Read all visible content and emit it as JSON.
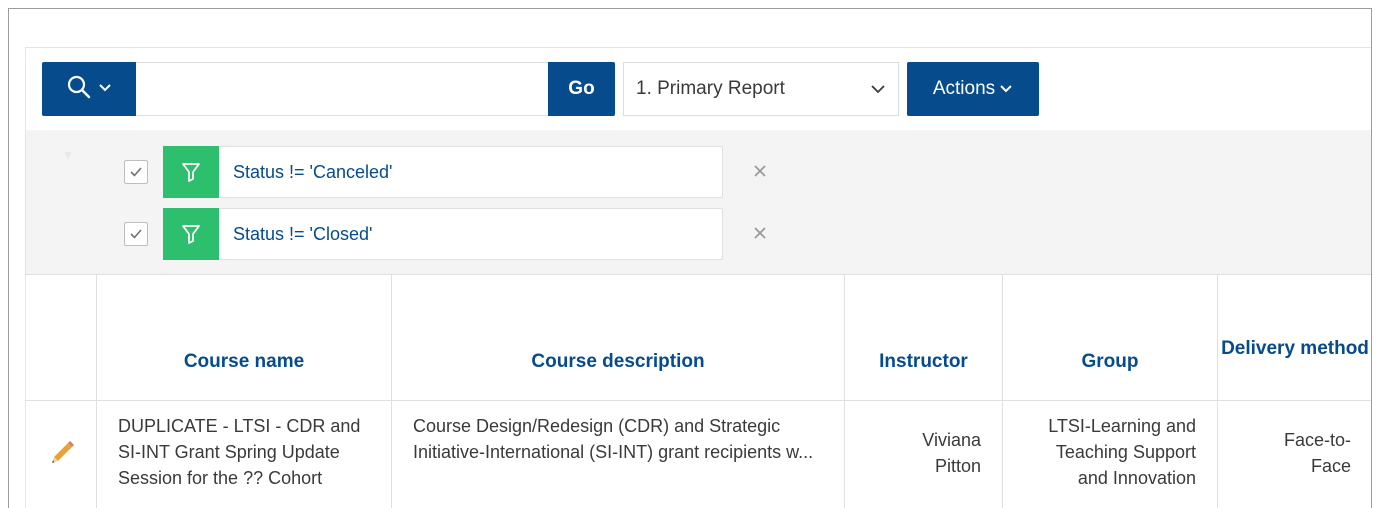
{
  "toolbar": {
    "search_value": "",
    "go_label": "Go",
    "report_selected": "1. Primary Report",
    "actions_label": "Actions"
  },
  "filters": [
    {
      "text": "Status != 'Canceled'",
      "checked": true
    },
    {
      "text": "Status != 'Closed'",
      "checked": true
    }
  ],
  "table": {
    "columns": [
      "",
      "Course name",
      "Course description",
      "Instructor",
      "Group",
      "Delivery method"
    ],
    "rows": [
      {
        "course_name": "DUPLICATE - LTSI - CDR and SI-INT Grant Spring Update Session for the ?? Cohort",
        "course_description": "Course Design/Redesign (CDR) and Strategic Initiative-International (SI-INT) grant recipients w...",
        "instructor": "Viviana Pitton",
        "group": "LTSI-Learning and Teaching Support and Innovation",
        "delivery_method": "Face-to-Face"
      }
    ]
  },
  "colors": {
    "primary": "#064b8c",
    "filter_green": "#2ebf6e",
    "edit_icon": "#e8a23a"
  },
  "icons": [
    "search-icon",
    "chevron-down-icon",
    "filter-icon",
    "check-icon",
    "close-icon",
    "pencil-icon"
  ]
}
